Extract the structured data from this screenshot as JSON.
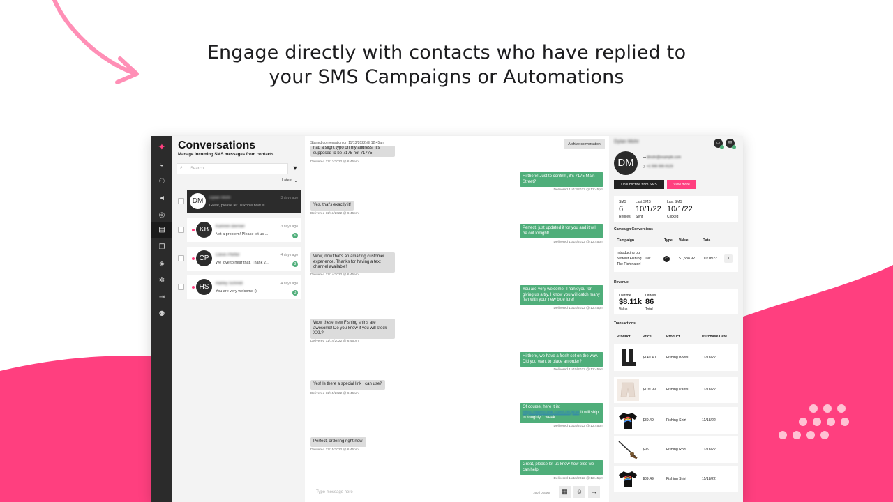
{
  "headline": {
    "line1": "Engage directly with contacts who have replied to",
    "line2": "your SMS Campaigns or Automations"
  },
  "colors": {
    "accent": "#ff3f7f",
    "sent_bubble": "#4fae7a",
    "dark": "#2b2b2b"
  },
  "sidebar": {
    "icons": [
      "logo-icon",
      "dashboard-icon",
      "contacts-icon",
      "campaigns-icon",
      "automations-icon",
      "conversations-icon",
      "templates-icon",
      "integrations-icon",
      "settings-icon",
      "logout-icon",
      "account-icon"
    ]
  },
  "conversations": {
    "title": "Conversations",
    "subtitle": "Manage incoming SMS messages from contacts",
    "search_placeholder": "Search",
    "sort_label": "Latest",
    "items": [
      {
        "initials": "DM",
        "name": "Dylan Mohr",
        "preview": "Great, please let us know how el...",
        "time": "3 days ago",
        "badge": "",
        "active": true
      },
      {
        "initials": "KB",
        "name": "Kamren Bernier",
        "preview": "Not a problem! Please let us ...",
        "time": "3 days ago",
        "badge": "6",
        "active": false
      },
      {
        "initials": "CP",
        "name": "Cleve Pfeffer",
        "preview": "We love to hear that. Thank y...",
        "time": "4 days ago",
        "badge": "3",
        "active": false
      },
      {
        "initials": "HS",
        "name": "Harley Schmitt",
        "preview": "You are very welcome :)",
        "time": "4 days ago",
        "badge": "3",
        "active": false
      }
    ]
  },
  "chat": {
    "started": "Started conversation on 11/13/2022 @ 12:45am",
    "archive_label": "Archive conversation",
    "messages": [
      {
        "dir": "in",
        "text": "had a slight typo on my address. It's supposed to be 7175 not 71775",
        "meta": "Delivered 11/13/2022 @ 6:45am"
      },
      {
        "dir": "out",
        "text": "Hi there! Just to confirm, it's 7175 Main Street?",
        "meta": "Delivered 11/13/2022 @ 12:45pm"
      },
      {
        "dir": "in",
        "text": "Yes, that's exactly it!",
        "meta": "Delivered 11/13/2022 @ 6:45pm"
      },
      {
        "dir": "out",
        "text": "Perfect, just updated it for you and it will be out tonight!",
        "meta": "Delivered 11/14/2022 @ 12:45pm"
      },
      {
        "dir": "in",
        "text": "Wow, now that's an amazing customer experience. Thanks for having a text channel available!",
        "meta": "Delivered 11/14/2022 @ 6:45am"
      },
      {
        "dir": "out",
        "text": "You are very welcome. Thank you for giving us a try. I know you will catch many fish with your new blue lure!",
        "meta": "Delivered 11/14/2022 @ 12:45pm"
      },
      {
        "dir": "in",
        "text": "Wow these new Fishing shirts are awesome! Do you know if you will stock XXL?",
        "meta": "Delivered 11/14/2022 @ 6:45pm"
      },
      {
        "dir": "out",
        "text": "Hi there, we have a fresh set on the way. Did you want to place an order?",
        "meta": "Delivered 11/15/2022 @ 12:45am"
      },
      {
        "dir": "in",
        "text": "Yes! Is there a special link I can use?",
        "meta": "Delivered 11/15/2022 @ 6:45am"
      },
      {
        "dir": "out",
        "text_before": "Of course, here it is:",
        "link": "https://demo.link.com/UXQ834",
        "text_after": "It will ship in roughly 1 week.",
        "meta": "Delivered 11/15/2022 @ 12:45pm"
      },
      {
        "dir": "in",
        "text": "Perfect, ordering right now!",
        "meta": "Delivered 11/15/2022 @ 6:45pm"
      },
      {
        "dir": "out",
        "text": "Great, please let us know how else we can help!",
        "meta": "Delivered 11/16/2022 @ 12:45pm"
      }
    ],
    "compose_placeholder": "Type message here",
    "compose_count": "160 | 0 SMS"
  },
  "contact": {
    "name": "Dylan Mohr",
    "initials": "DM",
    "email": "dmohr@example.com",
    "phone": "+1 555 555 0123",
    "unsubscribe_label": "Unsubscribe from SMS",
    "view_more_label": "View more",
    "stats": {
      "sms_label": "SMS",
      "sms_value": "6",
      "sms_sub": "Replies",
      "last_sent_label": "Last SMS",
      "last_sent_value": "10/1/22",
      "last_sent_sub": "Sent",
      "last_clicked_label": "Last SMS",
      "last_clicked_value": "10/1/22",
      "last_clicked_sub": "Clicked"
    },
    "campaign_conversions": {
      "title": "Campaign Conversions",
      "headers": [
        "Campaign",
        "Type",
        "Value",
        "Date"
      ],
      "rows": [
        {
          "campaign_l1": "Introducing our",
          "campaign_l2": "Newest Fishing Lure:",
          "campaign_l3": "The Fishinator!",
          "value": "$1,538.92",
          "date": "11/18/22"
        }
      ]
    },
    "revenue": {
      "title": "Revenue",
      "lifetime_label": "Lifetime",
      "lifetime_value": "$8.11k",
      "lifetime_sub": "Value",
      "orders_label": "Orders",
      "orders_value": "86",
      "orders_sub": "Total"
    },
    "transactions": {
      "title": "Transactions",
      "headers": [
        "Product",
        "Price",
        "Product",
        "Purchase Date"
      ],
      "rows": [
        {
          "image": "boots-icon",
          "price": "$140.40",
          "product": "Fishing Boots",
          "date": "11/18/22"
        },
        {
          "image": "pants-icon",
          "price": "$109.99",
          "product": "Fishing Pants",
          "date": "11/18/22"
        },
        {
          "image": "shirt-icon",
          "price": "$89.49",
          "product": "Fishing Shirt",
          "date": "11/18/22"
        },
        {
          "image": "rod-icon",
          "price": "$95",
          "product": "Fishing Rod",
          "date": "11/18/22"
        },
        {
          "image": "shirt-icon",
          "price": "$89.49",
          "product": "Fishing Shirt",
          "date": "11/18/22"
        }
      ]
    }
  }
}
